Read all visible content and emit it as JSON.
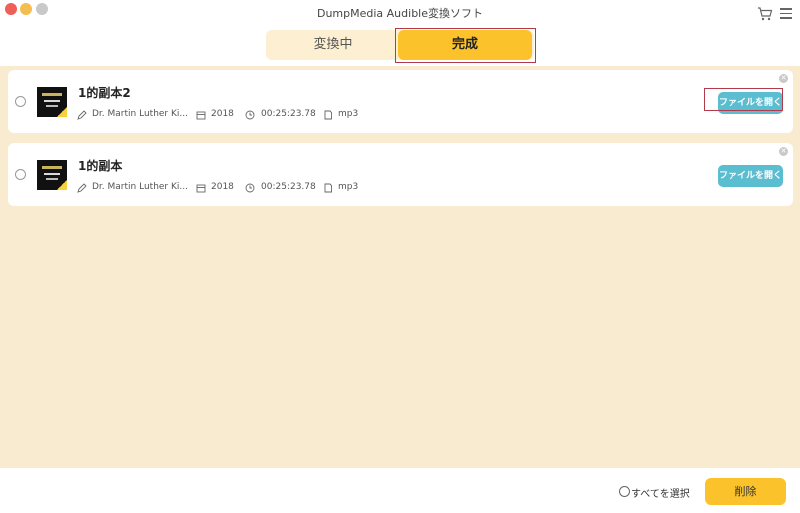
{
  "window": {
    "title": "DumpMedia Audible変換ソフト"
  },
  "tabs": {
    "converting": "変換中",
    "done": "完成"
  },
  "items": [
    {
      "title": "1的副本2",
      "author": "Dr. Martin Luther Ki...",
      "year": "2018",
      "duration": "00:25:23.78",
      "format": "mp3",
      "open_label": "ファイルを開く"
    },
    {
      "title": "1的副本",
      "author": "Dr. Martin Luther Ki...",
      "year": "2018",
      "duration": "00:25:23.78",
      "format": "mp3",
      "open_label": "ファイルを開く"
    }
  ],
  "footer": {
    "select_all": "すべてを選択",
    "delete": "削除"
  },
  "colors": {
    "accent": "#fbc22b",
    "button_blue": "#5bbdd0",
    "background": "#f9ebcf"
  }
}
